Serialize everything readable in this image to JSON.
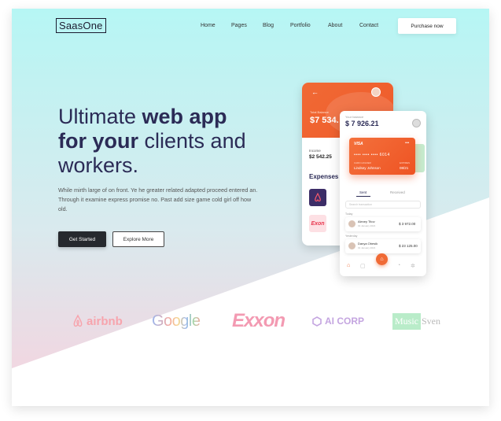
{
  "brand": {
    "logo_text": "SaasOne"
  },
  "nav": {
    "items": [
      "Home",
      "Pages",
      "Blog",
      "Portfolio",
      "About",
      "Contact"
    ],
    "cta": "Purchase now"
  },
  "hero": {
    "title_line1_plain": "Ultimate ",
    "title_line1_bold": "web app",
    "title_line2_bold": "for your",
    "title_line2_plain": " clients and",
    "title_line3": "workers.",
    "body": "While mirth large of on front. Ye he greater related adapted proceed entered an. Through it examine express promise no. Past add size game cold girl off how old.",
    "primary_button": "Get Started",
    "secondary_button": "Explore More"
  },
  "phone_back": {
    "total_balance_label": "Total Balance",
    "total_balance": "$7 534.",
    "income_label": "Income",
    "income": "$2 542.25",
    "expenses_title": "Expenses"
  },
  "phone_front": {
    "balance_label": "Your balance",
    "balance": "$ 7 926.21",
    "card": {
      "brand": "VISA",
      "menu": "•••",
      "number": "•••• •••• •••• 6014",
      "holder_label": "CARD HOLDER",
      "holder": "Lindsey Johnson",
      "expiry_label": "EXPIRES",
      "expiry": "08/21"
    },
    "tabs": [
      "Sent",
      "Received"
    ],
    "search_placeholder": "Search transaction",
    "day1": "Today",
    "day2": "Yesterday",
    "transactions": [
      {
        "name": "Alexey Titov",
        "date": "01 January 2021",
        "amount": "$ 3 972.00"
      },
      {
        "name": "Danya Obesik",
        "date": "01 January 2021",
        "amount": "$ 23 125.00"
      }
    ]
  },
  "partner_logos": [
    "airbnb",
    "Google",
    "Exxon",
    "AI CORP",
    "Music",
    "Sven"
  ],
  "colors": {
    "accent": "#f06a35",
    "heading": "#2b2b56",
    "dark_button": "#26292e"
  }
}
